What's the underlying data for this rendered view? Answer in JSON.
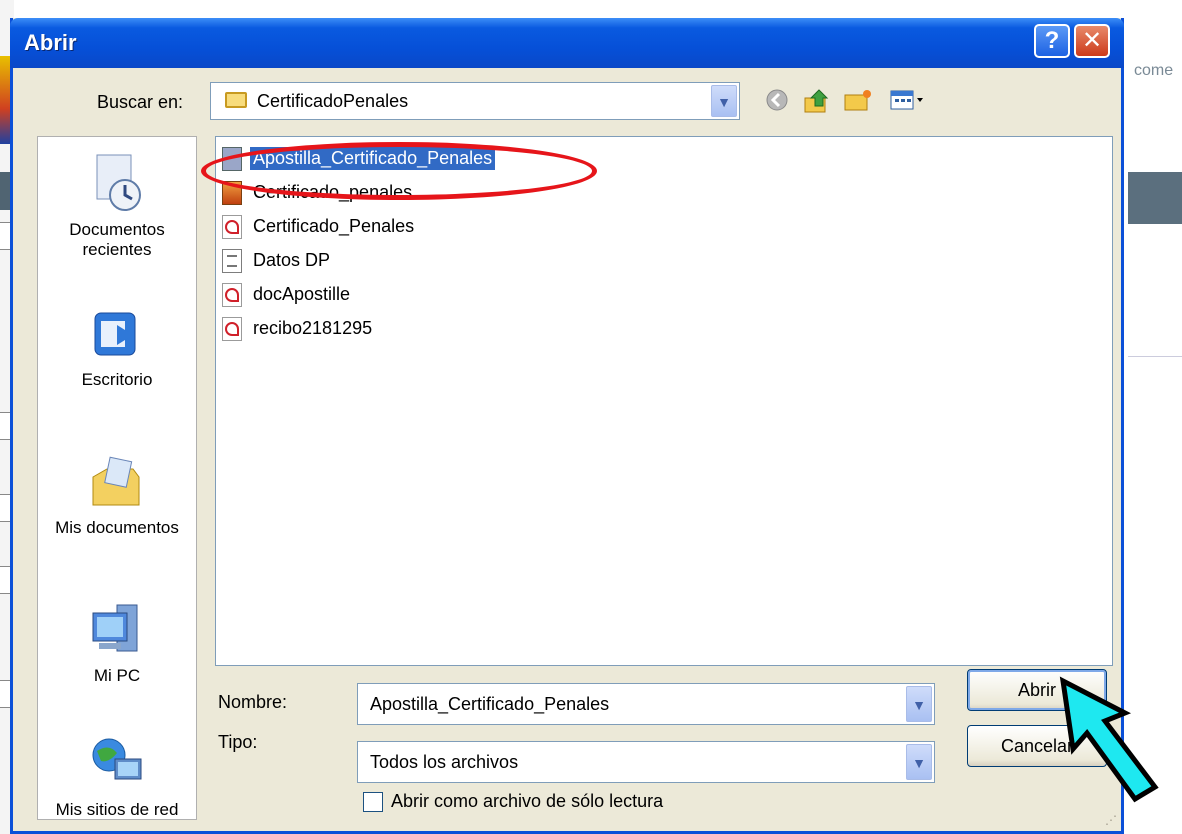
{
  "background": {
    "right_text": "come"
  },
  "dialog": {
    "title": "Abrir",
    "help_label": "?",
    "close_label": "✕"
  },
  "lookin": {
    "label": "Buscar en:",
    "value": "CertificadoPenales"
  },
  "toolbar": {
    "icons": [
      "back-icon",
      "up-folder-icon",
      "new-folder-icon",
      "view-menu-icon"
    ]
  },
  "places": [
    {
      "label": "Documentos recientes",
      "icon": "recent-documents-icon"
    },
    {
      "label": "Escritorio",
      "icon": "desktop-icon"
    },
    {
      "label": "Mis documentos",
      "icon": "my-documents-icon"
    },
    {
      "label": "Mi PC",
      "icon": "my-computer-icon"
    },
    {
      "label": "Mis sitios de red",
      "icon": "network-places-icon"
    }
  ],
  "files": [
    {
      "name": "Apostilla_Certificado_Penales",
      "type": "pdf",
      "selected": true
    },
    {
      "name": "Certificado_penales",
      "type": "image",
      "selected": false
    },
    {
      "name": "Certificado_Penales",
      "type": "pdf",
      "selected": false
    },
    {
      "name": "Datos DP",
      "type": "doc",
      "selected": false
    },
    {
      "name": "docApostille",
      "type": "pdf",
      "selected": false
    },
    {
      "name": "recibo2181295",
      "type": "pdf",
      "selected": false
    }
  ],
  "filename": {
    "label": "Nombre:",
    "value": "Apostilla_Certificado_Penales"
  },
  "filetype": {
    "label": "Tipo:",
    "value": "Todos los archivos"
  },
  "readonly": {
    "label": "Abrir como archivo de sólo lectura",
    "checked": false
  },
  "buttons": {
    "open": "Abrir",
    "cancel": "Cancelar"
  },
  "colors": {
    "title_bar": "#0a5ae0",
    "selection": "#316ac5",
    "highlight_ellipse": "#e6151a",
    "cursor_arrow": "#1ee8f0"
  }
}
